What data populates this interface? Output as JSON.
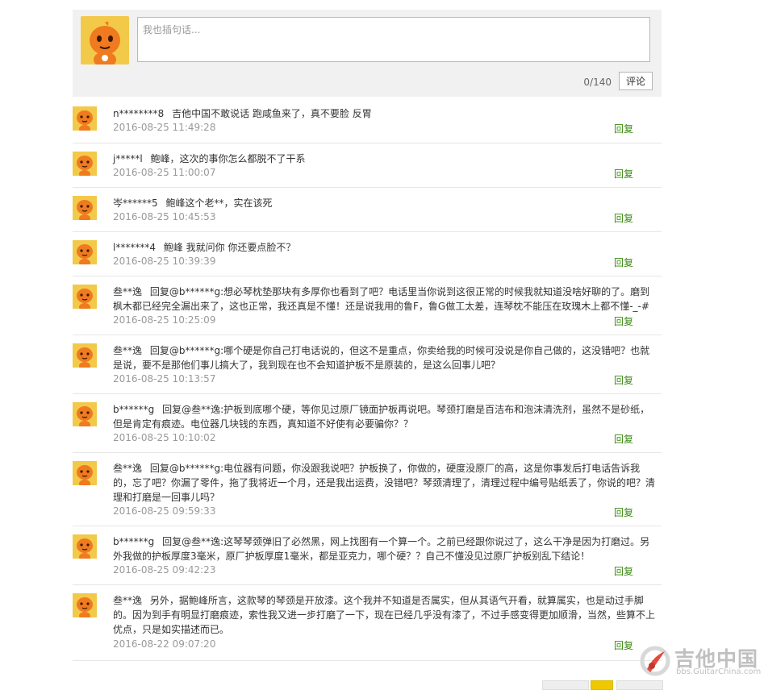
{
  "composer": {
    "placeholder": "我也插句话...",
    "counter": "0/140",
    "submit_label": "评论"
  },
  "comments": [
    {
      "user": "n********8",
      "content": "吉他中国不敢说话 跑咸鱼来了，真不要脸 反胃",
      "time": "2016-08-25 11:49:28",
      "reply": "回复"
    },
    {
      "user": "j*****l",
      "content": "鲍峰，这次的事你怎么都脱不了干系",
      "time": "2016-08-25 11:00:07",
      "reply": "回复"
    },
    {
      "user": "岑******5",
      "content": "鲍峰这个老**，实在该死",
      "time": "2016-08-25 10:45:53",
      "reply": "回复"
    },
    {
      "user": "l*******4",
      "content": "鲍峰 我就问你 你还要点脸不？",
      "time": "2016-08-25 10:39:39",
      "reply": "回复"
    },
    {
      "user": "叁**逸",
      "content": "回复@b******g:想必琴枕垫那块有多厚你也看到了吧？电话里当你说到这很正常的时候我就知道没啥好聊的了。磨到枫木都已经完全漏出来了，这也正常，我还真是不懂！还是说我用的鲁F，鲁G做工太差，连琴枕不能压在玫瑰木上都不懂-_-#",
      "time": "2016-08-25 10:25:09",
      "reply": "回复"
    },
    {
      "user": "叁**逸",
      "content": "回复@b******g:哪个硬是你自己打电话说的，但这不是重点，你卖给我的时候可没说是你自己做的，这没错吧？也就是说，要不是那他们事儿搞大了，我到现在也不会知道护板不是原装的，是这么回事儿吧？",
      "time": "2016-08-25 10:13:57",
      "reply": "回复"
    },
    {
      "user": "b******g",
      "content": "回复@叁**逸:护板到底哪个硬，等你见过原厂镜面护板再说吧。琴颈打磨是百洁布和泡沫清洗剂，虽然不是砂纸，但是肯定有痕迹。电位器几块钱的东西，真知道不好使有必要骗你？？",
      "time": "2016-08-25 10:10:02",
      "reply": "回复"
    },
    {
      "user": "叁**逸",
      "content": "回复@b******g:电位器有问题，你没跟我说吧？护板换了，你做的，硬度没原厂的高，这是你事发后打电话告诉我的，忘了吧？你漏了零件，拖了我将近一个月，还是我出运费，没错吧？琴颈清理了，清理过程中编号贴纸丢了，你说的吧？清理和打磨是一回事儿吗？",
      "time": "2016-08-25 09:59:33",
      "reply": "回复"
    },
    {
      "user": "b******g",
      "content": "回复@叁**逸:这琴琴颈弹旧了必然黑，网上找图有一个算一个。之前已经跟你说过了，这么干净是因为打磨过。另外我做的护板厚度3毫米，原厂护板厚度1毫米，都是亚克力，哪个硬？？自己不懂没见过原厂护板别乱下结论！",
      "time": "2016-08-25 09:42:23",
      "reply": "回复"
    },
    {
      "user": "叁**逸",
      "content": "另外，据鲍峰所言，这款琴的琴颈是开放漆。这个我并不知道是否属实，但从其语气开看，就算属实，也是动过手脚的。因为到手有明显打磨痕迹，索性我又进一步打磨了一下，现在已经几乎没有漆了，不过手感变得更加顺滑，当然，些算不上优点，只是如实描述而已。",
      "time": "2016-08-22 09:07:20",
      "reply": "回复"
    }
  ],
  "footer": {
    "logo_text": "吉他中国",
    "logo_url": "bbs.GuitarChina.com"
  },
  "colors": {
    "reply_link": "#3a8a10",
    "timestamp": "#999999",
    "composer_bg": "#f1f1f1",
    "pager_active": "#f0c800",
    "avatar_bg": "#f3c94a",
    "mascot_orange": "#f07a1f"
  }
}
